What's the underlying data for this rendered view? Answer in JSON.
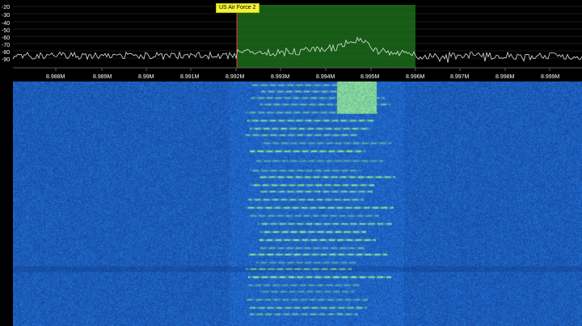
{
  "spectrum": {
    "db_labels": [
      "-20",
      "-30",
      "-40",
      "-50",
      "-60",
      "-70",
      "-80",
      "-90"
    ],
    "freq_labels": [
      "8.988M",
      "8.989M",
      "8.99M",
      "8.991M",
      "8.992M",
      "8.993M",
      "8.994M",
      "8.995M",
      "8.996M",
      "8.997M",
      "8.998M",
      "8.999M"
    ],
    "marker": {
      "label": "US Air Force 2",
      "start_freq": "8.992M",
      "end_freq": "8.996M",
      "fill_color": "#1f7a1f",
      "edge_color": "#ff3030"
    },
    "trace_color": "#d8e8d8",
    "grid_color": "#3a3a3a"
  },
  "waterfall": {
    "background_color": "#0b2f78",
    "signal_color": "#7dff7d"
  }
}
